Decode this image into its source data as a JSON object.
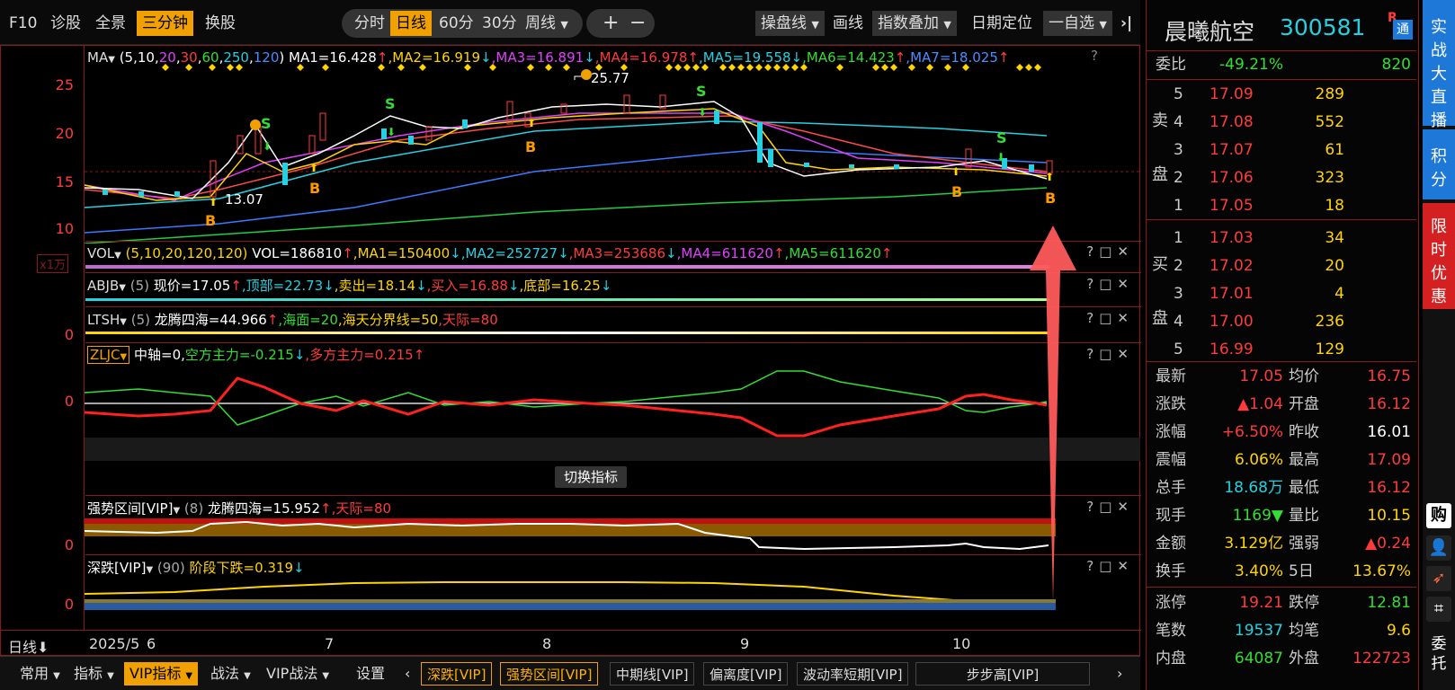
{
  "toolbar": {
    "f10": "F10",
    "diagnose": "诊股",
    "panorama": "全景",
    "three_min": "三分钟",
    "switch_stock": "换股",
    "fenshi": "分时",
    "rixian": "日线",
    "min60": "60分",
    "min30": "30分",
    "zhouxian": "周线",
    "zoom_in": "+",
    "zoom_out": "−",
    "pan_line": "操盘线",
    "draw_line": "画线",
    "index_overlay": "指数叠加",
    "date_locate": "日期定位",
    "custom": "一自选",
    "close": "X"
  },
  "ma_pane": {
    "label": "MA",
    "params_prefix": "(5,10,",
    "params": [
      "20",
      "30",
      "60",
      "250",
      "120"
    ],
    "ma1": "MA1=16.428",
    "ma2": "MA2=16.919",
    "ma3": "MA3=16.891",
    "ma4": "MA4=16.978",
    "ma5": "MA5=19.558",
    "ma6": "MA6=14.423",
    "ma7": "MA7=18.025",
    "help": "?",
    "y_ticks": [
      "25",
      "20",
      "15",
      "10"
    ],
    "high_label": "25.77",
    "low_label": "13.07"
  },
  "vol_pane": {
    "label": "VOL",
    "params": "(5,10,20,120,120)",
    "vol": "VOL=186810",
    "ma1": "MA1=150400",
    "ma2": "MA2=252727",
    "ma3": "MA3=253686",
    "ma4": "MA4=611620",
    "ma5": "MA5=611620",
    "unit": "x1万"
  },
  "abjb_pane": {
    "label": "ABJB",
    "params": "(5)",
    "price": "现价=17.05",
    "top": "顶部=22.73",
    "sell": "卖出=18.14",
    "buy": "买入=16.88",
    "bottom": "底部=16.25"
  },
  "ltsh_pane": {
    "label": "LTSH",
    "params": "(5)",
    "ltsh": "龙腾四海=44.966",
    "haimian": "海面=20",
    "haitian": "海天分界线=50",
    "tianji": "天际=80",
    "zero": "0"
  },
  "zljc_pane": {
    "label": "ZLJC",
    "zhongzhou": "中轴=0,",
    "kong": "空方主力=-0.215",
    "duo": "多方主力=0.215",
    "zero": "0",
    "switch_btn": "切换指标"
  },
  "qsqj_pane": {
    "label": "强势区间[VIP]",
    "params": "(8)",
    "ltsh": "龙腾四海=15.952",
    "tianji": "天际=80",
    "zero": "0"
  },
  "sd_pane": {
    "label": "深跌[VIP]",
    "params": "(90)",
    "jdxd": "阶段下跌=0.319",
    "zero": "0"
  },
  "xaxis": {
    "period": "日线",
    "labels": [
      "2025/5",
      "6",
      "7",
      "8",
      "9",
      "10"
    ]
  },
  "bottombar": {
    "tabs": [
      "常用",
      "指标",
      "VIP指标",
      "战法",
      "VIP战法",
      "设置"
    ],
    "vip_tabs": [
      "深跌[VIP]",
      "强势区间[VIP]",
      "中期线[VIP]",
      "偏离度[VIP]",
      "波动率短期[VIP]",
      "步步高[VIP]"
    ]
  },
  "stock": {
    "name": "晨曦航空",
    "code": "300581",
    "badge_r": "R",
    "badge_tong": "通",
    "weibi_label": "委比",
    "weibi_value": "-49.21%",
    "weicha_value": "820",
    "sell_label": [
      "卖",
      "盘"
    ],
    "buy_label": [
      "买",
      "盘"
    ],
    "asks": [
      {
        "level": "5",
        "price": "17.09",
        "vol": "289"
      },
      {
        "level": "4",
        "price": "17.08",
        "vol": "552"
      },
      {
        "level": "3",
        "price": "17.07",
        "vol": "61"
      },
      {
        "level": "2",
        "price": "17.06",
        "vol": "323"
      },
      {
        "level": "1",
        "price": "17.05",
        "vol": "18"
      }
    ],
    "bids": [
      {
        "level": "1",
        "price": "17.03",
        "vol": "34"
      },
      {
        "level": "2",
        "price": "17.02",
        "vol": "20"
      },
      {
        "level": "3",
        "price": "17.01",
        "vol": "4"
      },
      {
        "level": "4",
        "price": "17.00",
        "vol": "236"
      },
      {
        "level": "5",
        "price": "16.99",
        "vol": "129"
      }
    ],
    "stats": [
      {
        "l1": "最新",
        "v1": "17.05",
        "c1": "#ff3b3b",
        "l2": "均价",
        "v2": "16.75",
        "c2": "#ff3b3b"
      },
      {
        "l1": "涨跌",
        "v1": "▲1.04",
        "c1": "#ff3b3b",
        "l2": "开盘",
        "v2": "16.12",
        "c2": "#ff3b3b"
      },
      {
        "l1": "涨幅",
        "v1": "+6.50%",
        "c1": "#ff3b3b",
        "l2": "昨收",
        "v2": "16.01",
        "c2": "#ffffff"
      },
      {
        "l1": "震幅",
        "v1": "6.06%",
        "c1": "#ffd400",
        "l2": "最高",
        "v2": "17.09",
        "c2": "#ff3b3b"
      },
      {
        "l1": "总手",
        "v1": "18.68万",
        "c1": "#25d0e0",
        "l2": "最低",
        "v2": "16.12",
        "c2": "#ff3b3b"
      },
      {
        "l1": "现手",
        "v1": "1169▼",
        "c1": "#33dd33",
        "l2": "量比",
        "v2": "10.15",
        "c2": "#ffd400"
      },
      {
        "l1": "金额",
        "v1": "3.129亿",
        "c1": "#ffd400",
        "l2": "强弱",
        "v2": "▲0.24",
        "c2": "#ff3b3b"
      },
      {
        "l1": "换手",
        "v1": "3.40%",
        "c1": "#ffd400",
        "l2": "5日",
        "v2": "13.67%",
        "c2": "#ffd400"
      },
      {
        "l1": "涨停",
        "v1": "19.21",
        "c1": "#ff3b3b",
        "l2": "跌停",
        "v2": "12.81",
        "c2": "#33dd33"
      },
      {
        "l1": "笔数",
        "v1": "19537",
        "c1": "#25d0e0",
        "l2": "均笔",
        "v2": "9.6",
        "c2": "#ffd400"
      },
      {
        "l1": "内盘",
        "v1": "64087",
        "c1": "#33dd33",
        "l2": "外盘",
        "v2": "122723",
        "c2": "#ff3b3b"
      }
    ]
  },
  "sidebar": {
    "live": "实战大直播",
    "points": "积分",
    "promo": "限时优惠",
    "buy": "购",
    "entrust": "委托"
  },
  "colors": {
    "accent": "#f0a000",
    "up": "#ff3b3b",
    "down": "#33dd33",
    "panel_border": "#8a1a1a",
    "live_bg": "#1e78d8",
    "promo_bg": "#d42020"
  }
}
